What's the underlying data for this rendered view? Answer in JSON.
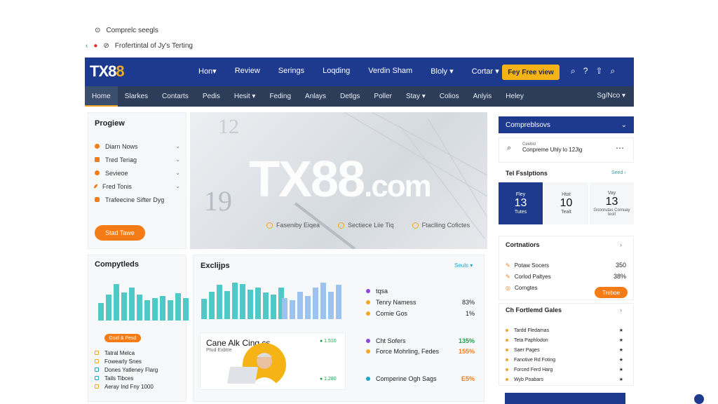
{
  "browser": {
    "tab_title": "Comprelc seegls",
    "page_title": "Frofertintal of Jy's Terting"
  },
  "header": {
    "logo_main": "TX8",
    "logo_accent": "8",
    "nav": [
      "Hon▾",
      "Review",
      "Serings",
      "Loqding",
      "Verdin Sham",
      "Bloly ▾",
      "Cortar ▾"
    ],
    "cta": "Fey Free view"
  },
  "subnav": {
    "items": [
      "Home",
      "Slarkes",
      "Contarts",
      "Pedis",
      "Hesit ▾",
      "Feding",
      "Anlays",
      "Detlgs",
      "Poller",
      "Stay ▾",
      "Colios",
      "Anlyis",
      "Heley"
    ],
    "right": "Sg/Nco ▾"
  },
  "left": {
    "title": "Progiew",
    "items": [
      "Diarn Nows",
      "Tred Teriag",
      "Sevieoe",
      "Fred Tonis",
      "Trafeecine Sifter Dyg"
    ],
    "button": "Stad Tawe",
    "item_colors": [
      "#f47b16",
      "#f47b16",
      "#f47b16",
      "#f47b16",
      "#f47b16"
    ]
  },
  "hero": {
    "big_main": "TX88",
    "big_suffix": ".com",
    "features": [
      "Faseniby Eiqea",
      "Sectiece Liie Tiq",
      "Ftaclling Cofictes"
    ]
  },
  "comp": {
    "title": "Compytleds",
    "badge": "Gsid & Pesd",
    "items": [
      "Tatral Melca",
      "Fowearly Snes",
      "Dones Yatleney Flarg",
      "Tails Tibces",
      "Aeray Ind Fny 1000"
    ],
    "item_colors": [
      "#f5a623",
      "#f5a623",
      "#19a7c9",
      "#19a7c9",
      "#f5a623"
    ]
  },
  "explore": {
    "title": "Exclijps",
    "filter": "Seuls ▾",
    "legend": [
      {
        "label": "tqsa",
        "value": "",
        "color": "#8e44d9"
      },
      {
        "label": "Tenry Namess",
        "value": "83%",
        "color": "#f5a623"
      },
      {
        "label": "Comie Gos",
        "value": "1%",
        "color": "#f5a623"
      }
    ],
    "feature_title": "Cane Alk Cing.cs",
    "feature_sub": "Ptud Exbtre",
    "feature_tag1": "● 1.510",
    "feature_tag2": "● 1.280",
    "stats": [
      {
        "label": "Cht Sofers",
        "value": "135%",
        "color": "#8e44d9",
        "value_color": "#1e9e4a"
      },
      {
        "label": "Force Mohrling, Fedes",
        "value": "155%",
        "color": "#f5a623",
        "value_color": "#f47b16"
      },
      {
        "label": "Comperine Ogh Sags",
        "value": "E5%",
        "color": "#19a7c9",
        "value_color": "#f47b16"
      }
    ]
  },
  "right": {
    "header": "Compreblsovs",
    "search_text": "Conpreme Uhly lo 12Jlg",
    "search_small": "Ceebld",
    "sessions_title": "Tel Fsslptions",
    "sessions_link": "Seed ›",
    "cal": [
      {
        "top": "Fley",
        "num": "13",
        "bottom": "Tutes",
        "sel": true
      },
      {
        "top": "Htat",
        "num": "10",
        "bottom": "Tealt",
        "sel": false
      },
      {
        "top": "Vay",
        "num": "13",
        "bottom": "Goonrutas Comuay testl",
        "sel": false
      }
    ],
    "cornmatiors_title": "Cortnatiors",
    "cornmatiors": [
      {
        "label": "Potaw Socers",
        "value": "350"
      },
      {
        "label": "Corlod Paltyes",
        "value": "38%"
      },
      {
        "label": "Corngtes",
        "value": ""
      }
    ],
    "cornmatiors_button": "Treboe",
    "gates_title": "Ch Fortlemd Gales",
    "gates": [
      "Tardd Fledamas",
      "Teta Paphlodon",
      "Saer Pages",
      "Fanotive Rd Foting",
      "Forced Ferd Harg",
      "Wyb Poabars"
    ]
  },
  "colors": {
    "navy": "#1d3a8f",
    "orange": "#f47b16",
    "amber": "#f5b316",
    "teal": "#4fc8c8",
    "blue": "#9cc3ee"
  },
  "chart_data": [
    {
      "type": "bar",
      "values": [
        30,
        44,
        62,
        48,
        56,
        44,
        34,
        38,
        42,
        34,
        46,
        38
      ],
      "color": "#4fc8c8"
    },
    {
      "type": "bar",
      "values": [
        34,
        45,
        56,
        46,
        60,
        58,
        48,
        52,
        44,
        40,
        52
      ],
      "color": "#4fc8c8"
    },
    {
      "type": "bar",
      "values": [
        40,
        36,
        52,
        44,
        60,
        70,
        52,
        66
      ],
      "color": "#9cc3ee"
    }
  ]
}
